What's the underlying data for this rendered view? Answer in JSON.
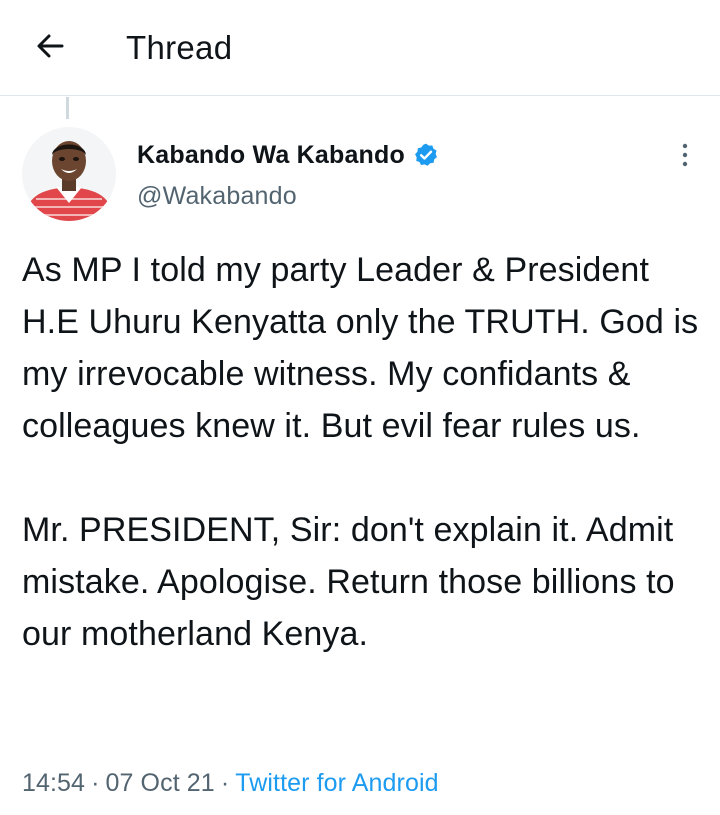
{
  "header": {
    "back_icon": "arrow-left-icon",
    "title": "Thread"
  },
  "tweet": {
    "author": {
      "name": "Kabando Wa Kabando",
      "handle": "@Wakabando",
      "verified_icon": "verified-badge-icon",
      "verified_color": "#1d9bf0"
    },
    "more_icon": "more-vertical-icon",
    "paragraphs": [
      "As MP I told my party Leader & President H.E Uhuru Kenyatta only the TRUTH. God is my irrevocable witness. My confidants &  colleagues knew it. But evil fear rules us.",
      "Mr. PRESIDENT, Sir: don't explain it. Admit mistake. Apologise. Return those billions to our motherland Kenya."
    ],
    "time": "14:54",
    "date": "07 Oct 21",
    "separator": "·",
    "source": "Twitter for Android"
  },
  "colors": {
    "text": "#0f1419",
    "secondary_text": "#536471",
    "link": "#1d9bf0",
    "divider": "#e1e6ea"
  }
}
